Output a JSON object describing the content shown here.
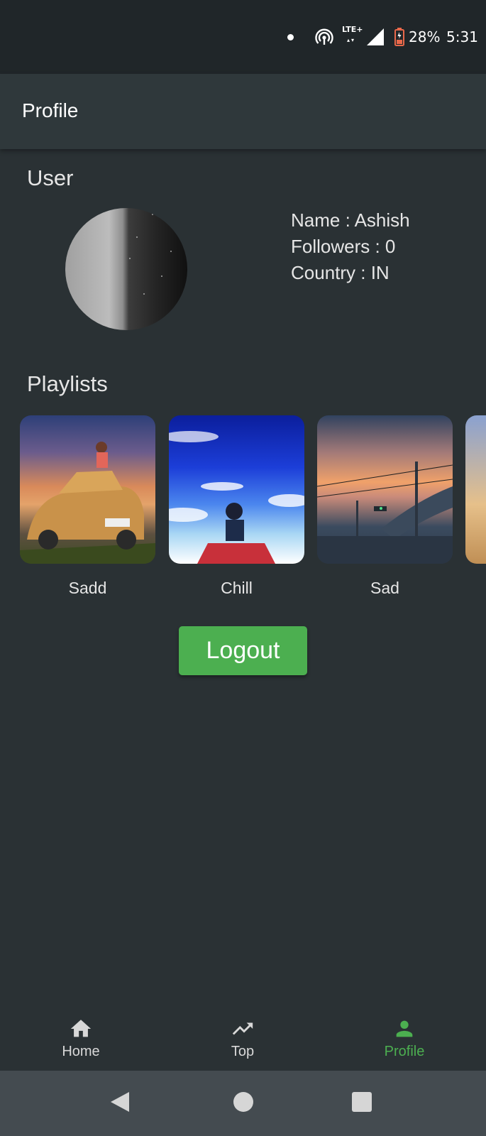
{
  "status_bar": {
    "network": "LTE+",
    "battery": "28%",
    "time": "5:31",
    "icons": [
      "dot-icon",
      "hotspot-icon",
      "lte-icon",
      "signal-icon",
      "battery-icon"
    ]
  },
  "app_bar": {
    "title": "Profile"
  },
  "user": {
    "section_title": "User",
    "name": "Name : Ashish",
    "followers": "Followers : 0",
    "country": "Country : IN"
  },
  "playlists": {
    "section_title": "Playlists",
    "items": [
      {
        "name": "Sadd"
      },
      {
        "name": "Chill"
      },
      {
        "name": "Sad"
      }
    ]
  },
  "logout": {
    "label": "Logout"
  },
  "bottom_nav": {
    "items": [
      {
        "label": "Home",
        "icon": "home-icon"
      },
      {
        "label": "Top",
        "icon": "trending-up-icon"
      },
      {
        "label": "Profile",
        "icon": "person-icon",
        "active": true
      }
    ]
  },
  "colors": {
    "accent": "#4caf50",
    "background": "#2a3134",
    "app_bar": "#2f383b",
    "status_bar": "#202629",
    "system_nav": "#444b50"
  }
}
